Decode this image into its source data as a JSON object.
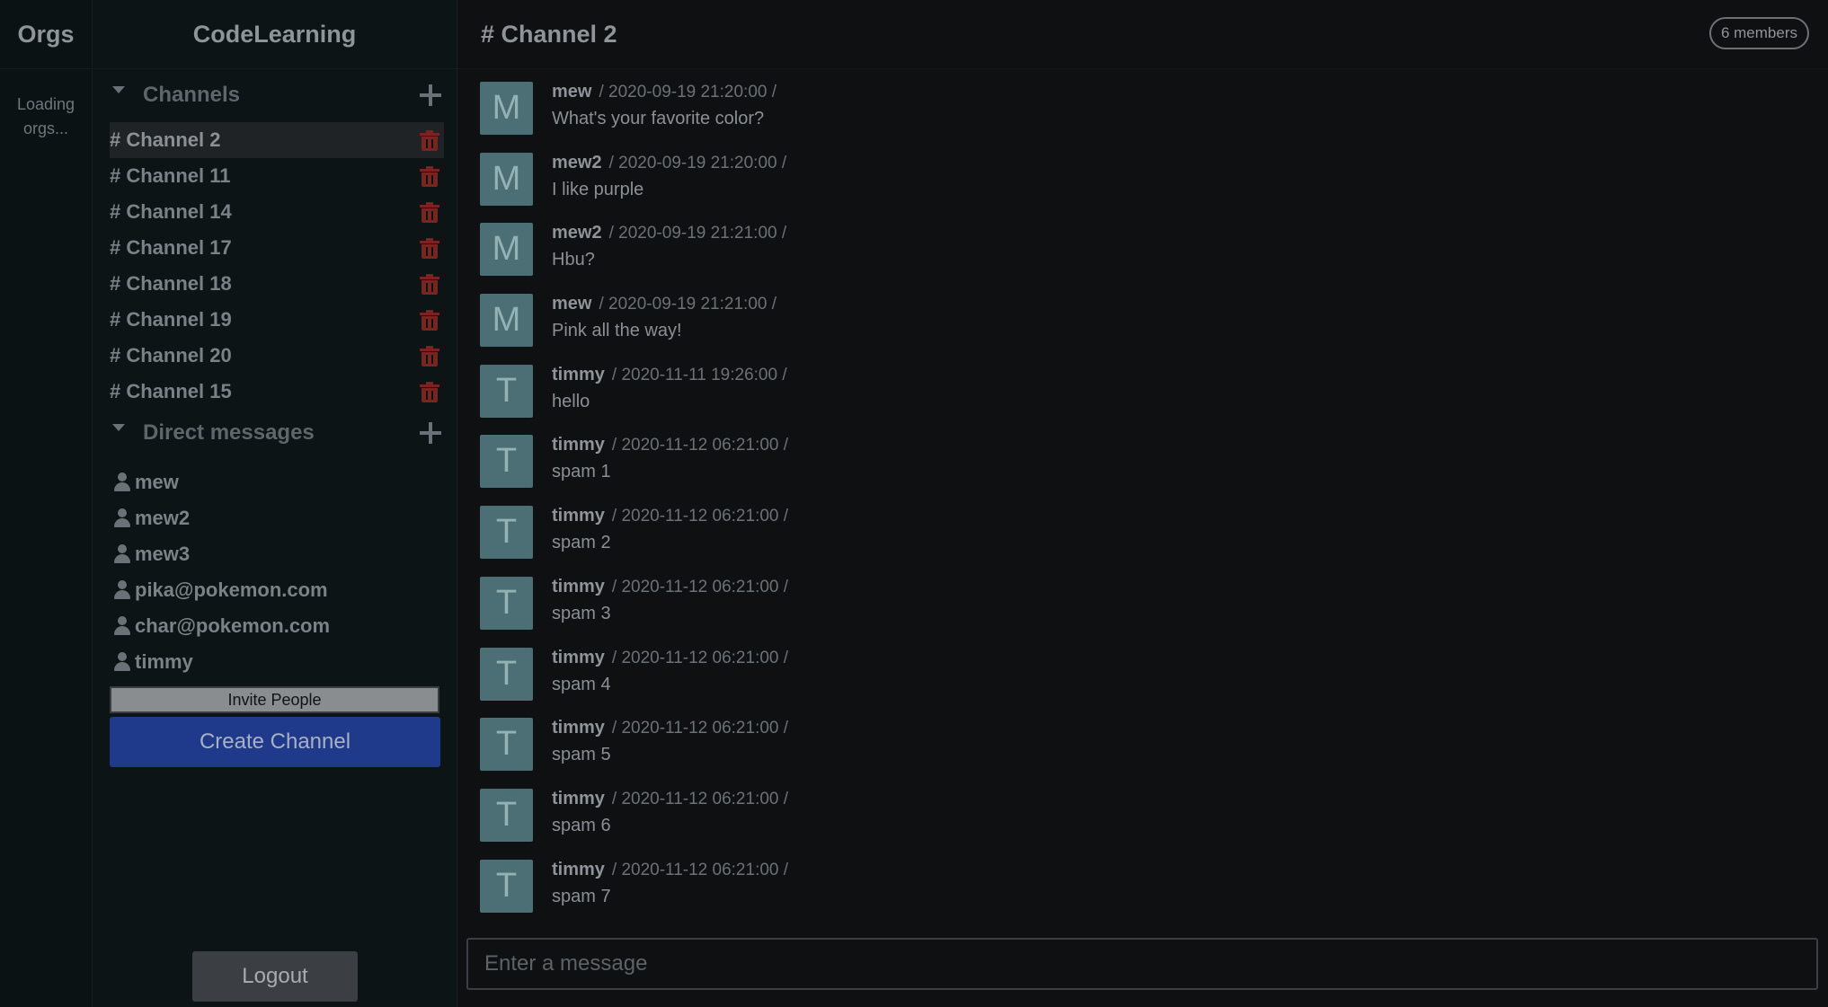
{
  "orgs": {
    "title": "Orgs",
    "loading_text": "Loading orgs..."
  },
  "sidebar": {
    "workspace_title": "CodeLearning",
    "channels_label": "Channels",
    "channels": [
      {
        "label": "# Channel 2",
        "active": true
      },
      {
        "label": "# Channel 11"
      },
      {
        "label": "# Channel 14"
      },
      {
        "label": "# Channel 17"
      },
      {
        "label": "# Channel 18"
      },
      {
        "label": "# Channel 19"
      },
      {
        "label": "# Channel 20"
      },
      {
        "label": "# Channel 15"
      }
    ],
    "dm_label": "Direct messages",
    "direct_messages": [
      {
        "label": "mew"
      },
      {
        "label": "mew2"
      },
      {
        "label": "mew3"
      },
      {
        "label": "pika@pokemon.com"
      },
      {
        "label": "char@pokemon.com"
      },
      {
        "label": "timmy"
      }
    ],
    "invite_label": "Invite People",
    "create_channel_label": "Create Channel",
    "logout_label": "Logout"
  },
  "chat": {
    "title": "# Channel 2",
    "members_label": "6 members",
    "input_placeholder": "Enter a message",
    "messages": [
      {
        "initial": "M",
        "user": "mew",
        "time": "/ 2020-09-19 21:20:00 /",
        "text": "What's your favorite color?"
      },
      {
        "initial": "M",
        "user": "mew2",
        "time": "/ 2020-09-19 21:20:00 /",
        "text": "I like purple"
      },
      {
        "initial": "M",
        "user": "mew2",
        "time": "/ 2020-09-19 21:21:00 /",
        "text": "Hbu?"
      },
      {
        "initial": "M",
        "user": "mew",
        "time": "/ 2020-09-19 21:21:00 /",
        "text": "Pink all the way!"
      },
      {
        "initial": "T",
        "user": "timmy",
        "time": "/ 2020-11-11 19:26:00 /",
        "text": "hello"
      },
      {
        "initial": "T",
        "user": "timmy",
        "time": "/ 2020-11-12 06:21:00 /",
        "text": "spam 1"
      },
      {
        "initial": "T",
        "user": "timmy",
        "time": "/ 2020-11-12 06:21:00 /",
        "text": "spam 2"
      },
      {
        "initial": "T",
        "user": "timmy",
        "time": "/ 2020-11-12 06:21:00 /",
        "text": "spam 3"
      },
      {
        "initial": "T",
        "user": "timmy",
        "time": "/ 2020-11-12 06:21:00 /",
        "text": "spam 4"
      },
      {
        "initial": "T",
        "user": "timmy",
        "time": "/ 2020-11-12 06:21:00 /",
        "text": "spam 5"
      },
      {
        "initial": "T",
        "user": "timmy",
        "time": "/ 2020-11-12 06:21:00 /",
        "text": "spam 6"
      },
      {
        "initial": "T",
        "user": "timmy",
        "time": "/ 2020-11-12 06:21:00 /",
        "text": "spam 7"
      }
    ]
  },
  "colors": {
    "background": "#0e1012",
    "sidebar": "#0c1416",
    "accent_button": "#1f3a8a",
    "delete_icon": "#7a2420",
    "avatar": "#4b6f74"
  },
  "icons": {
    "section_toggle": "caret-down-icon",
    "add": "plus-icon",
    "delete": "trash-icon",
    "user": "person-icon"
  }
}
